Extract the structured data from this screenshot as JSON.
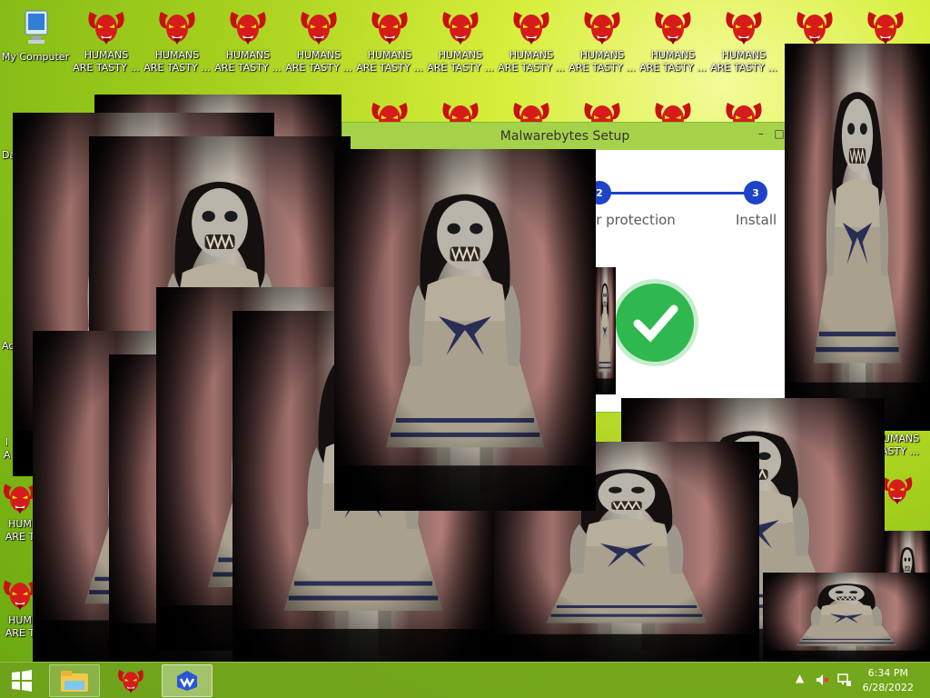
{
  "desktop": {
    "my_computer_label": "My Computer",
    "icon_label_line1": "HUMANS",
    "icon_label_line2": "ARE TASTY ...",
    "partial_left_labels": [
      "Da",
      "Ac",
      "I",
      "A"
    ],
    "partial_label_human": "HUM",
    "partial_label_aret": "ARE T",
    "right_label_line1": "HUMANS",
    "right_label_line2": "TASTY ..."
  },
  "window": {
    "title": "Malwarebytes Setup",
    "steps": [
      {
        "number": "2",
        "label": "er protection"
      },
      {
        "number": "3",
        "label": "Install"
      }
    ],
    "accent": "#1d43c9",
    "success": "#2eb84f"
  },
  "taskbar": {
    "time": "6:34 PM",
    "date": "6/28/2022",
    "items": [
      "windows-start-icon",
      "file-explorer-icon",
      "demon-app-icon",
      "malwarebytes-icon"
    ],
    "tray_icons": [
      "show-hidden-icons-arrow",
      "volume-muted-icon",
      "network-icon"
    ]
  },
  "colors": {
    "desktop_green": "#a7d11e",
    "demon_red": "#d61b1b",
    "taskbar": "#6ea01e"
  }
}
